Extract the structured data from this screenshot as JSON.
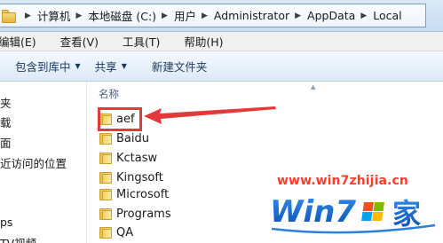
{
  "address_bar": {
    "breadcrumbs": [
      "计算机",
      "本地磁盘 (C:)",
      "用户",
      "Administrator",
      "AppData",
      "Local"
    ]
  },
  "menu_bar": {
    "items": [
      "编辑(E)",
      "查看(V)",
      "工具(T)",
      "帮助(H)"
    ]
  },
  "command_bar": {
    "include_in_library": "包含到库中",
    "share": "共享",
    "new_folder": "新建文件夹"
  },
  "nav_pane": {
    "items": [
      "夹",
      "载",
      "面",
      "近访问的位置",
      "ps",
      "TV视频"
    ]
  },
  "content": {
    "column_header": "名称",
    "folders": [
      "aef",
      "Baidu",
      "Kctasw",
      "Kingsoft",
      "Microsoft",
      "Programs",
      "QA"
    ]
  },
  "annotation": {
    "highlight_color": "#e23a3a"
  },
  "watermark": {
    "url": "www.win7zhijia.cn",
    "logo_text": "Win7",
    "logo_suffix": "家"
  }
}
